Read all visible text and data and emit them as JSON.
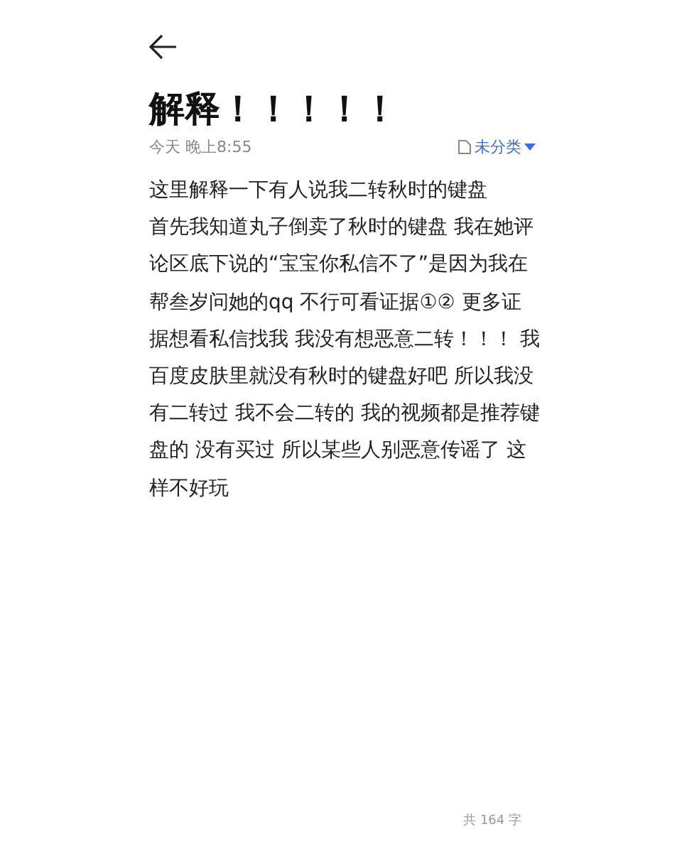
{
  "note": {
    "title": "解释！！！！！",
    "date": "今天 晚上8:55",
    "category": "未分类",
    "body_lines": [
      "这里解释一下有人说我二转秋时的键盘",
      "首先我知道丸子倒卖了秋时的键盘 我在她评",
      "论区底下说的“宝宝你私信不了”是因为我在",
      "帮叁岁问她的qq 不行可看证据①② 更多证",
      "据想看私信找我 我没有想恶意二转！！！ 我",
      "百度皮肤里就没有秋时的键盘好吧 所以我没",
      "有二转过 我不会二转的 我的视频都是推荐键",
      "盘的 没有买过 所以某些人别恶意传谣了 这",
      "样不好玩"
    ],
    "word_count": "共 164 字"
  }
}
